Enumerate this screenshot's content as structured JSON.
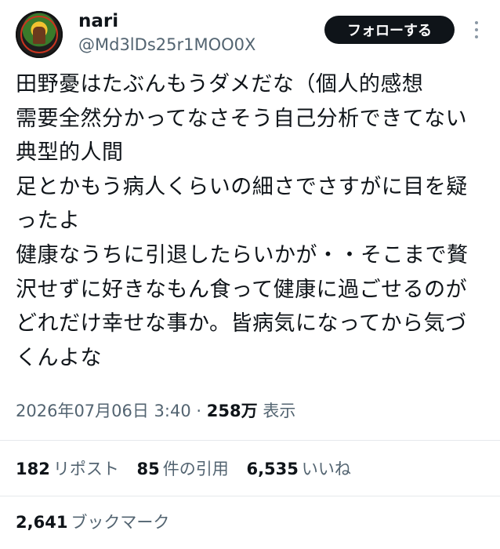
{
  "user": {
    "name": "nari",
    "handle": "@Md3lDs25r1MOO0X"
  },
  "follow_button": {
    "label": "フォローする"
  },
  "tweet": {
    "text": "田野憂はたぶんもうダメだな（個人的感想\n需要全然分かってなさそう自己分析できてない典型的人間\n足とかもう病人くらいの細さでさすがに目を疑ったよ\n健康なうちに引退したらいかが・・そこまで贅沢せずに好きなもん食って健康に過ごせるのがどれだけ幸せな事か。皆病気になってから気づくんよな"
  },
  "meta": {
    "timestamp": "2026年07月06日 3:40",
    "separator": "·",
    "views_count": "258万",
    "views_label": "表示"
  },
  "stats": {
    "reposts": {
      "count": "182",
      "label": "リポスト"
    },
    "quotes": {
      "count": "85",
      "label": "件の引用"
    },
    "likes": {
      "count": "6,535",
      "label": "いいね"
    },
    "bookmarks": {
      "count": "2,641",
      "label": "ブックマーク"
    }
  },
  "icons": {
    "avatar": "profile-avatar",
    "more": "more-vertical-icon"
  },
  "colors": {
    "text": "#0f1419",
    "secondary": "#536471",
    "follow_bg": "#0f1419",
    "divider": "#e6e9ec"
  }
}
